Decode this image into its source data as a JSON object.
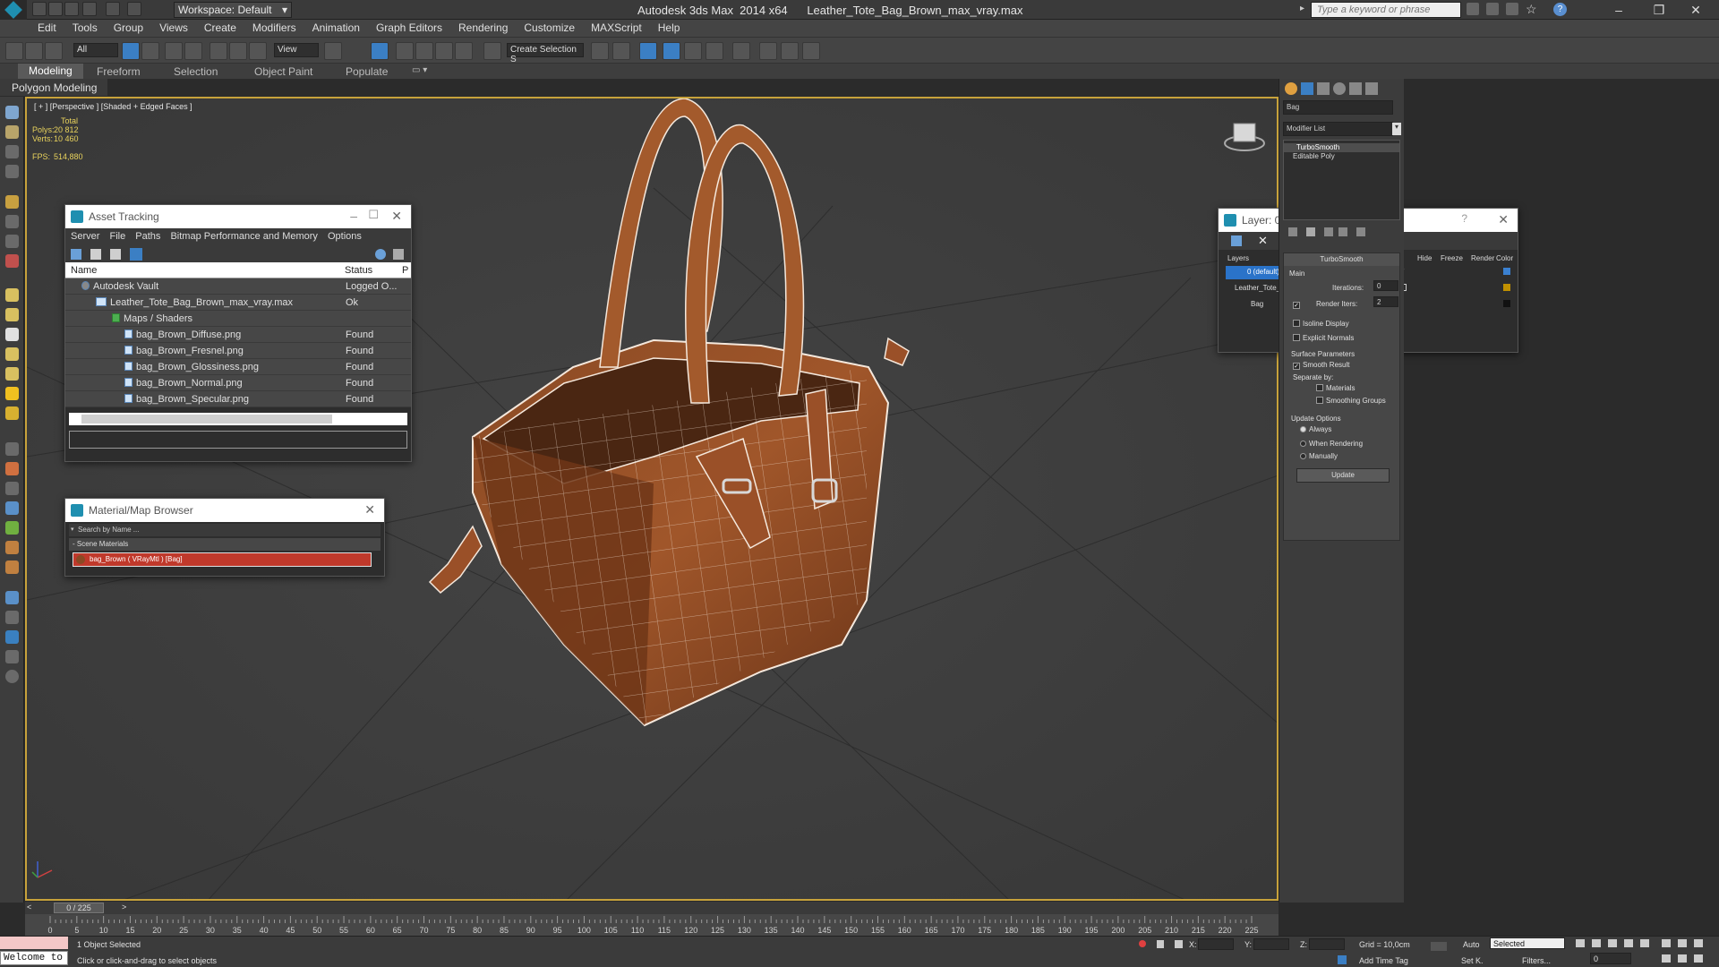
{
  "titlebar": {
    "title": "Autodesk 3ds Max  2014 x64      Leather_Tote_Bag_Brown_max_vray.max",
    "workspace": "Workspace: Default",
    "search_placeholder": "Type a keyword or phrase"
  },
  "menu": [
    "Edit",
    "Tools",
    "Group",
    "Views",
    "Create",
    "Modifiers",
    "Animation",
    "Graph Editors",
    "Rendering",
    "Customize",
    "MAXScript",
    "Help"
  ],
  "toolbar": {
    "selection_filter": "All",
    "ref_coord": "View",
    "named_selection": "Create Selection S"
  },
  "ribbon": {
    "tabs": [
      "Modeling",
      "Freeform",
      "Selection",
      "Object Paint",
      "Populate"
    ],
    "active": "Modeling",
    "panel": "Polygon Modeling"
  },
  "viewport": {
    "label": "[ + ] [Perspective ] [Shaded + Edged Faces ]",
    "stats": {
      "total_label": "Total",
      "polys_label": "Polys:",
      "polys": "20 812",
      "verts_label": "Verts:",
      "verts": "10 460",
      "fps_label": "FPS:",
      "fps": "514,880"
    }
  },
  "asset_tracking": {
    "title": "Asset Tracking",
    "menu": [
      "Server",
      "File",
      "Paths",
      "Bitmap Performance and Memory",
      "Options"
    ],
    "columns": [
      "Name",
      "Status",
      "P"
    ],
    "rows": [
      {
        "name": "Autodesk Vault",
        "status": "Logged O..."
      },
      {
        "name": "Leather_Tote_Bag_Brown_max_vray.max",
        "status": "Ok"
      },
      {
        "name": "Maps / Shaders",
        "status": ""
      },
      {
        "name": "bag_Brown_Diffuse.png",
        "status": "Found"
      },
      {
        "name": "bag_Brown_Fresnel.png",
        "status": "Found"
      },
      {
        "name": "bag_Brown_Glossiness.png",
        "status": "Found"
      },
      {
        "name": "bag_Brown_Normal.png",
        "status": "Found"
      },
      {
        "name": "bag_Brown_Specular.png",
        "status": "Found"
      }
    ]
  },
  "material_browser": {
    "title": "Material/Map Browser",
    "search_placeholder": "Search by Name ...",
    "group": "- Scene Materials",
    "item": "bag_Brown  ( VRayMtl )  [Bag]"
  },
  "layer_window": {
    "title": "Layer: 0 (default)",
    "columns": [
      "Layers",
      "Hide",
      "Freeze",
      "Render",
      "Color"
    ],
    "rows": [
      {
        "name": "0 (default)",
        "selected": true
      },
      {
        "name": "Leather_Tote_Bag_Brown",
        "selected": false
      },
      {
        "name": "Bag",
        "selected": false
      }
    ]
  },
  "command_panel": {
    "object_name": "Bag",
    "modifier_list": "Modifier List",
    "stack": [
      "TurboSmooth",
      "Editable Poly"
    ],
    "turbosmooth": {
      "title": "TurboSmooth",
      "main": "Main",
      "iterations_label": "Iterations:",
      "iterations": "0",
      "render_iters_label": "Render Iters:",
      "render_iters": "2",
      "isoline": "Isoline Display",
      "explicit": "Explicit Normals",
      "surface_params": "Surface Parameters",
      "smooth_result": "Smooth Result",
      "separate_by": "Separate by:",
      "materials": "Materials",
      "smoothing_groups": "Smoothing Groups",
      "update_options": "Update Options",
      "always": "Always",
      "when_rendering": "When Rendering",
      "manually": "Manually",
      "update_btn": "Update"
    }
  },
  "timeline": {
    "frame": "0 / 225",
    "ticks": [
      "0",
      "5",
      "10",
      "15",
      "20",
      "25",
      "30",
      "35",
      "40",
      "45",
      "50",
      "55",
      "60",
      "65",
      "70",
      "75",
      "80",
      "85",
      "90",
      "95",
      "100",
      "105",
      "110",
      "115",
      "120",
      "125",
      "130",
      "135",
      "140",
      "145",
      "150",
      "155",
      "160",
      "165",
      "170",
      "175",
      "180",
      "185",
      "190",
      "195",
      "200",
      "205",
      "210",
      "215",
      "220",
      "225"
    ]
  },
  "status": {
    "maxscript": "Welcome to",
    "selected": "1 Object Selected",
    "prompt": "Click or click-and-drag to select objects",
    "x_label": "X:",
    "y_label": "Y:",
    "z_label": "Z:",
    "grid": "Grid = 10,0cm",
    "add_time_tag": "Add Time Tag",
    "auto": "Auto",
    "set_key": "Set K.",
    "selected_dd": "Selected",
    "filters": "Filters...",
    "frame_field": "0"
  }
}
